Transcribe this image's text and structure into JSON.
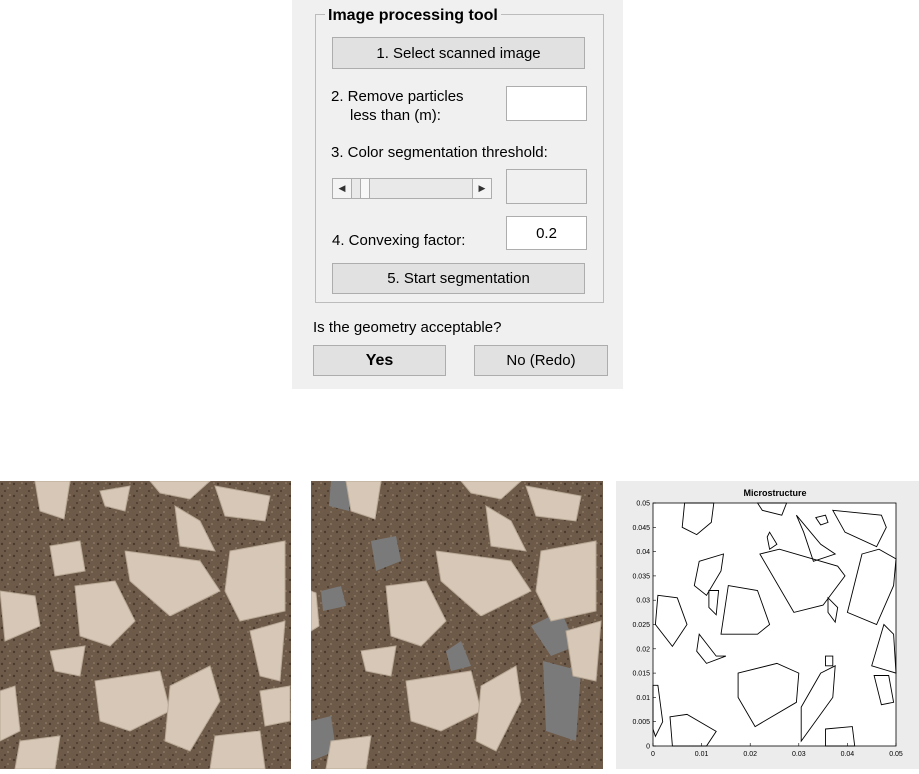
{
  "panel": {
    "group_title": "Image processing tool",
    "select_button": "1. Select scanned image",
    "remove_label_line1": "2. Remove particles",
    "remove_label_line2": "less than (m):",
    "remove_value": "",
    "threshold_label": "3. Color segmentation threshold:",
    "threshold_value": "",
    "slider_value_fraction": 0.08,
    "convex_label": "4.  Convexing factor:",
    "convex_value": "0.2",
    "start_button": "5. Start segmentation",
    "question": "Is the geometry acceptable?",
    "yes_button": "Yes",
    "no_button": "No (Redo)"
  },
  "images": {
    "original_name": "scanned-concrete-image",
    "segmented_name": "segmented-concrete-image"
  },
  "chart_data": {
    "type": "line",
    "title": "Microstructure",
    "xlim": [
      0,
      0.05
    ],
    "ylim": [
      0,
      0.05
    ],
    "xticks": [
      "0",
      "0.01",
      "0.02",
      "0.03",
      "0.04",
      "0.05"
    ],
    "yticks": [
      "0",
      "0.005",
      "0.01",
      "0.015",
      "0.02",
      "0.025",
      "0.03",
      "0.035",
      "0.04",
      "0.045",
      "0.05"
    ],
    "grid": false,
    "polygons": [
      [
        [
          0.0065,
          0.05
        ],
        [
          0.0125,
          0.05
        ],
        [
          0.012,
          0.046
        ],
        [
          0.009,
          0.0435
        ],
        [
          0.006,
          0.045
        ]
      ],
      [
        [
          0.0215,
          0.05
        ],
        [
          0.0275,
          0.05
        ],
        [
          0.0265,
          0.0475
        ],
        [
          0.0225,
          0.0485
        ]
      ],
      [
        [
          0.0295,
          0.0475
        ],
        [
          0.0345,
          0.0415
        ],
        [
          0.0375,
          0.0395
        ],
        [
          0.033,
          0.038
        ],
        [
          0.031,
          0.044
        ]
      ],
      [
        [
          0.0335,
          0.047
        ],
        [
          0.0355,
          0.0475
        ],
        [
          0.036,
          0.046
        ],
        [
          0.0345,
          0.0455
        ]
      ],
      [
        [
          0.037,
          0.0485
        ],
        [
          0.047,
          0.0475
        ],
        [
          0.048,
          0.045
        ],
        [
          0.046,
          0.041
        ],
        [
          0.0395,
          0.044
        ]
      ],
      [
        [
          0.024,
          0.044
        ],
        [
          0.0255,
          0.0415
        ],
        [
          0.024,
          0.0405
        ],
        [
          0.0235,
          0.043
        ]
      ],
      [
        [
          0.0095,
          0.038
        ],
        [
          0.0145,
          0.0395
        ],
        [
          0.014,
          0.036
        ],
        [
          0.011,
          0.031
        ],
        [
          0.0085,
          0.033
        ]
      ],
      [
        [
          0.022,
          0.0395
        ],
        [
          0.026,
          0.0405
        ],
        [
          0.038,
          0.037
        ],
        [
          0.0395,
          0.035
        ],
        [
          0.035,
          0.029
        ],
        [
          0.029,
          0.0275
        ]
      ],
      [
        [
          0.043,
          0.0395
        ],
        [
          0.0465,
          0.0405
        ],
        [
          0.05,
          0.0385
        ],
        [
          0.0495,
          0.033
        ],
        [
          0.046,
          0.025
        ],
        [
          0.04,
          0.0275
        ]
      ],
      [
        [
          0.001,
          0.031
        ],
        [
          0.005,
          0.0305
        ],
        [
          0.007,
          0.025
        ],
        [
          0.004,
          0.0205
        ],
        [
          0.0005,
          0.025
        ]
      ],
      [
        [
          0.0115,
          0.032
        ],
        [
          0.0135,
          0.032
        ],
        [
          0.013,
          0.027
        ],
        [
          0.0115,
          0.0285
        ]
      ],
      [
        [
          0.0155,
          0.033
        ],
        [
          0.0215,
          0.032
        ],
        [
          0.024,
          0.025
        ],
        [
          0.0215,
          0.023
        ],
        [
          0.014,
          0.023
        ]
      ],
      [
        [
          0.036,
          0.0305
        ],
        [
          0.038,
          0.0285
        ],
        [
          0.0375,
          0.0255
        ],
        [
          0.036,
          0.0275
        ]
      ],
      [
        [
          0.0475,
          0.025
        ],
        [
          0.0495,
          0.023
        ],
        [
          0.05,
          0.015
        ],
        [
          0.045,
          0.0165
        ]
      ],
      [
        [
          0.0095,
          0.023
        ],
        [
          0.013,
          0.0185
        ],
        [
          0.015,
          0.0185
        ],
        [
          0.011,
          0.017
        ],
        [
          0.009,
          0.0195
        ]
      ],
      [
        [
          0.0355,
          0.0185
        ],
        [
          0.037,
          0.0185
        ],
        [
          0.037,
          0.0165
        ],
        [
          0.0355,
          0.0165
        ]
      ],
      [
        [
          0.0175,
          0.015
        ],
        [
          0.0255,
          0.017
        ],
        [
          0.03,
          0.015
        ],
        [
          0.0295,
          0.009
        ],
        [
          0.021,
          0.004
        ],
        [
          0.0175,
          0.01
        ]
      ],
      [
        [
          0.0345,
          0.015
        ],
        [
          0.0375,
          0.0165
        ],
        [
          0.037,
          0.01
        ],
        [
          0.0305,
          0.001
        ],
        [
          0.0305,
          0.008
        ]
      ],
      [
        [
          0.0455,
          0.0145
        ],
        [
          0.0485,
          0.0145
        ],
        [
          0.0495,
          0.009
        ],
        [
          0.047,
          0.0085
        ]
      ],
      [
        [
          0.0,
          0.0125
        ],
        [
          0.001,
          0.0125
        ],
        [
          0.002,
          0.005
        ],
        [
          0.0005,
          0.002
        ],
        [
          0.0,
          0.0035
        ]
      ],
      [
        [
          0.0035,
          0.006
        ],
        [
          0.007,
          0.0065
        ],
        [
          0.013,
          0.003
        ],
        [
          0.011,
          0.0
        ],
        [
          0.004,
          0.0
        ]
      ],
      [
        [
          0.0355,
          0.0035
        ],
        [
          0.041,
          0.004
        ],
        [
          0.0415,
          0.0
        ],
        [
          0.0355,
          0.0
        ]
      ]
    ]
  }
}
